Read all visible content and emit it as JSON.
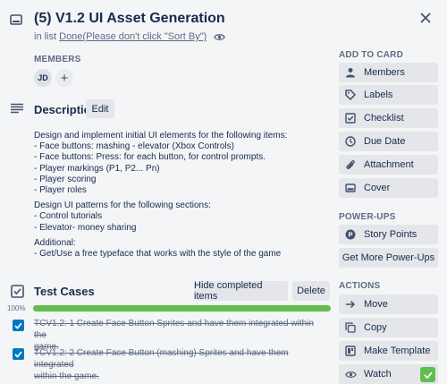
{
  "header": {
    "title": "(5) V1.2 UI Asset Generation",
    "in_list_prefix": "in list ",
    "list_name": "Done(Please don't click \"Sort By\")"
  },
  "members": {
    "label": "MEMBERS",
    "avatar_initials": "JD",
    "add_symbol": "+"
  },
  "description": {
    "heading": "Description",
    "edit_label": "Edit",
    "paragraphs": [
      [
        "Design and implement initial UI elements for the following items:",
        "- Face buttons: mashing - elevator (Xbox Controls)",
        "- Face buttons: Press: for each button, for control prompts.",
        "- Player markings (P1, P2... Pn)",
        "- Player scoring",
        "- Player roles"
      ],
      [
        "Design UI patterns for the following sections:",
        "- Control tutorials",
        "- Elevator- money sharing"
      ],
      [
        "Additional:",
        "- Get/Use a free typeface that works with the style of the game"
      ]
    ]
  },
  "checklist": {
    "heading": "Test Cases",
    "hide_label": "Hide completed items",
    "delete_label": "Delete",
    "progress_text": "100%",
    "progress": 1.0,
    "items": [
      {
        "line1": "TCV1.2: 1 Create Face Button Sprites and have them integrated within the",
        "line2": "game.",
        "checked": true
      },
      {
        "line1": "TCV1.2: 2 Create Face Button (mashing) Sprites and have them integrated",
        "line2": "within the game.",
        "checked": true
      }
    ]
  },
  "sidebar": {
    "add_to_card": {
      "label": "ADD TO CARD",
      "items": [
        {
          "label": "Members",
          "icon": "person-icon"
        },
        {
          "label": "Labels",
          "icon": "label-icon"
        },
        {
          "label": "Checklist",
          "icon": "checklist-icon"
        },
        {
          "label": "Due Date",
          "icon": "clock-icon"
        },
        {
          "label": "Attachment",
          "icon": "paperclip-icon"
        },
        {
          "label": "Cover",
          "icon": "cover-icon"
        }
      ]
    },
    "power_ups": {
      "label": "POWER-UPS",
      "story_points": "Story Points",
      "get_more": "Get More Power-Ups"
    },
    "actions": {
      "label": "ACTIONS",
      "items": [
        {
          "label": "Move",
          "icon": "arrow-right-icon"
        },
        {
          "label": "Copy",
          "icon": "copy-icon"
        },
        {
          "label": "Make Template",
          "icon": "template-icon"
        },
        {
          "label": "Watch",
          "icon": "eye-icon"
        }
      ]
    }
  },
  "colors": {
    "accent": "#0079bf",
    "progress": "#61bd4f",
    "text": "#172b4d",
    "muted": "#5e6c84",
    "button_bg": "#e4e6ea"
  }
}
